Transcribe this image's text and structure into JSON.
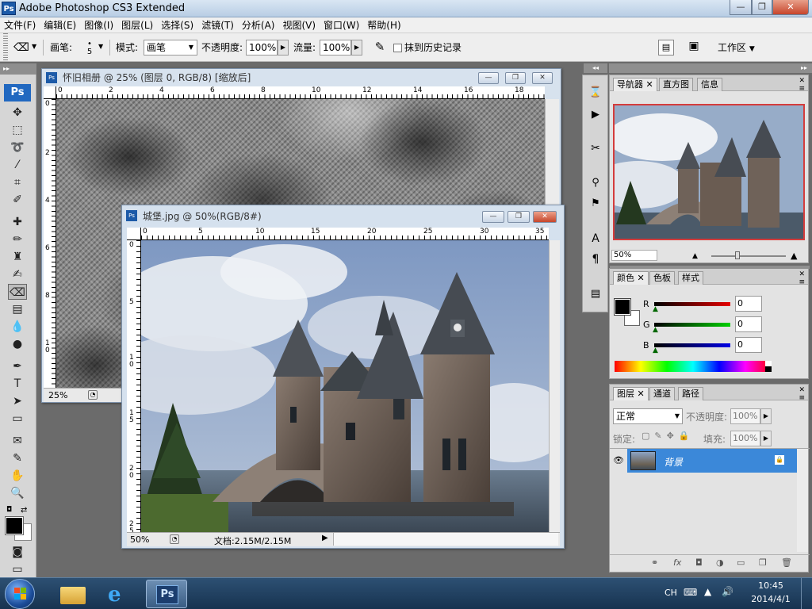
{
  "app": {
    "title": "Adobe Photoshop CS3 Extended",
    "ps_logo": "Ps"
  },
  "window_buttons": {
    "minimize": "—",
    "maximize": "❐",
    "close": "✕"
  },
  "menu": [
    "文件(F)",
    "编辑(E)",
    "图像(I)",
    "图层(L)",
    "选择(S)",
    "滤镜(T)",
    "分析(A)",
    "视图(V)",
    "窗口(W)",
    "帮助(H)"
  ],
  "options": {
    "brush_label": "画笔:",
    "brush_size": "5",
    "mode_label": "模式:",
    "mode_value": "画笔",
    "opacity_label": "不透明度:",
    "opacity_value": "100%",
    "flow_label": "流量:",
    "flow_value": "100%",
    "erase_history_label": "抹到历史记录",
    "workspace_label": "工作区"
  },
  "toolbox": {
    "logo": "Ps",
    "active_tool": "eraser-tool"
  },
  "doc1": {
    "title": "怀旧相册 @ 25% (图层 0, RGB/8) [缩放后]",
    "zoom": "25%",
    "ruler_h": [
      "0",
      "2",
      "4",
      "6",
      "8",
      "10",
      "12",
      "14",
      "16",
      "18"
    ],
    "ruler_v": [
      "0",
      "2",
      "4",
      "6",
      "8",
      "1 0"
    ]
  },
  "doc2": {
    "title": "城堡.jpg @ 50%(RGB/8#)",
    "zoom": "50%",
    "doc_info": "文档:2.15M/2.15M",
    "ruler_h": [
      "0",
      "5",
      "10",
      "15",
      "20",
      "25",
      "30",
      "35"
    ],
    "ruler_v": [
      "0",
      "5",
      "1 0",
      "1 5",
      "2 0",
      "2 5"
    ]
  },
  "navigator": {
    "tabs": [
      "导航器",
      "直方图",
      "信息"
    ],
    "zoom": "50%"
  },
  "color": {
    "tabs": [
      "颜色",
      "色板",
      "样式"
    ],
    "r_label": "R",
    "g_label": "G",
    "b_label": "B",
    "r": "0",
    "g": "0",
    "b": "0",
    "fg_color": "#000000",
    "bg_color": "#ffffff"
  },
  "layers": {
    "tabs": [
      "图层",
      "通道",
      "路径"
    ],
    "blend_mode": "正常",
    "opacity_label": "不透明度:",
    "opacity_value": "100%",
    "lock_label": "锁定:",
    "fill_label": "填充:",
    "fill_value": "100%",
    "layer_name": "背景"
  },
  "taskbar": {
    "lang": "CH",
    "time": "10:45",
    "date": "2014/4/1",
    "ps_label": "Ps"
  }
}
